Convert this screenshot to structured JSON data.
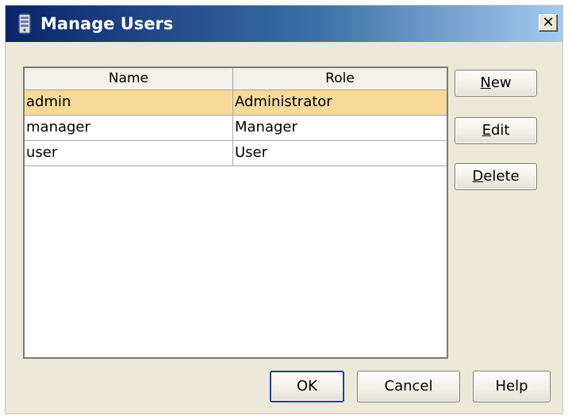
{
  "window": {
    "title": "Manage Users",
    "close_glyph": "✕"
  },
  "table": {
    "columns": [
      "Name",
      "Role"
    ],
    "rows": [
      {
        "name": "admin",
        "role": "Administrator",
        "selected": true
      },
      {
        "name": "manager",
        "role": "Manager",
        "selected": false
      },
      {
        "name": "user",
        "role": "User",
        "selected": false
      }
    ],
    "selection_color": "#f7d99a"
  },
  "buttons": {
    "new": {
      "mnemonic": "N",
      "rest": "ew"
    },
    "edit": {
      "mnemonic": "E",
      "rest": "dit"
    },
    "delete": {
      "mnemonic": "D",
      "rest": "elete"
    },
    "ok": "OK",
    "cancel": "Cancel",
    "help": "Help"
  },
  "icons": {
    "title": "server-icon",
    "close": "close-icon"
  },
  "colors": {
    "titlebar_start": "#0a246a",
    "titlebar_end": "#a6caf0",
    "dialog_bg": "#ece9d8",
    "default_button_border": "#1c3f95"
  }
}
